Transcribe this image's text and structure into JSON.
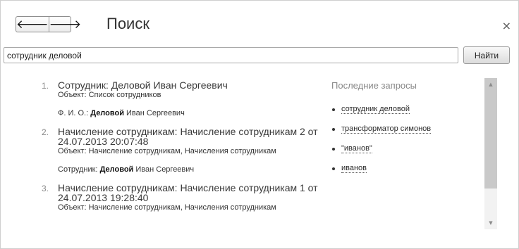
{
  "header": {
    "back_icon": "left-arrow-icon",
    "back_glyph": "🡐",
    "forward_icon": "right-arrow-icon",
    "forward_glyph": "🡒",
    "title": "Поиск",
    "close_icon": "close-icon",
    "close_glyph": "×"
  },
  "search": {
    "value": "сотрудник деловой",
    "button_label": "Найти"
  },
  "results": [
    {
      "number": "1.",
      "title": "Сотрудник: Деловой Иван Сергеевич",
      "object": "Объект: Список сотрудников",
      "field_prefix": "Ф. И. О.: ",
      "field_match": "Деловой",
      "field_rest": " Иван Сергеевич"
    },
    {
      "number": "2.",
      "title": "Начисление сотрудникам: Начисление сотрудникам 2 от 24.07.2013 20:07:48",
      "object": "Объект: Начисление сотрудникам, Начисления сотрудникам",
      "field_prefix": "Сотрудник: ",
      "field_match": "Деловой",
      "field_rest": " Иван Сергеевич"
    },
    {
      "number": "3.",
      "title": "Начисление сотрудникам: Начисление сотрудникам 1 от 24.07.2013 19:28:40",
      "object": "Объект: Начисление сотрудникам, Начисления сотрудникам"
    }
  ],
  "recent": {
    "title": "Последние запросы",
    "items": [
      "сотрудник деловой",
      "трансформатор симонов",
      "\"иванов\"",
      "иванов"
    ]
  },
  "scrollbar": {
    "up_icon": "scroll-up-arrow-icon",
    "up_glyph": "▲",
    "down_icon": "scroll-down-arrow-icon",
    "down_glyph": "▼"
  }
}
